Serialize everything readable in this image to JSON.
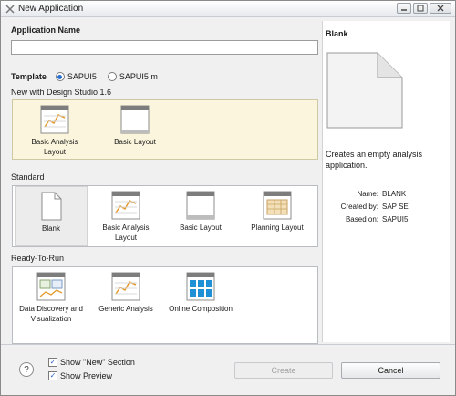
{
  "window": {
    "title": "New Application"
  },
  "form": {
    "app_name_label": "Application Name",
    "app_name_value": "",
    "template_label": "Template",
    "template_options": [
      "SAPUI5",
      "SAPUI5 m"
    ],
    "template_selected": "SAPUI5"
  },
  "sections": {
    "design_studio": {
      "title": "New with Design Studio 1.6",
      "tiles": [
        {
          "label": "Basic Analysis Layout",
          "icon": "chart-template-icon"
        },
        {
          "label": "Basic Layout",
          "icon": "layout-template-icon"
        }
      ]
    },
    "standard": {
      "title": "Standard",
      "tiles": [
        {
          "label": "Blank",
          "icon": "blank-page-icon"
        },
        {
          "label": "Basic Analysis Layout",
          "icon": "chart-template-icon"
        },
        {
          "label": "Basic Layout",
          "icon": "layout-template-icon"
        },
        {
          "label": "Planning Layout",
          "icon": "planning-template-icon"
        }
      ],
      "selected": "Blank"
    },
    "ready_to_run": {
      "title": "Ready-To-Run",
      "tiles": [
        {
          "label": "Data Discovery and Visualization",
          "icon": "data-discovery-icon"
        },
        {
          "label": "Generic Analysis",
          "icon": "chart-template-icon"
        },
        {
          "label": "Online Composition",
          "icon": "online-composition-icon"
        }
      ]
    }
  },
  "preview": {
    "title": "Blank",
    "description": "Creates an empty analysis application.",
    "name_key": "Name:",
    "name_value": "BLANK",
    "created_key": "Created by:",
    "created_value": "SAP SE",
    "based_key": "Based on:",
    "based_value": "SAPUI5"
  },
  "footer": {
    "show_new_section": "Show \"New\" Section",
    "show_preview": "Show Preview",
    "create_label": "Create",
    "cancel_label": "Cancel"
  },
  "colors": {
    "design_bg": "#faf5dc",
    "accent": "#2a6fd0"
  }
}
